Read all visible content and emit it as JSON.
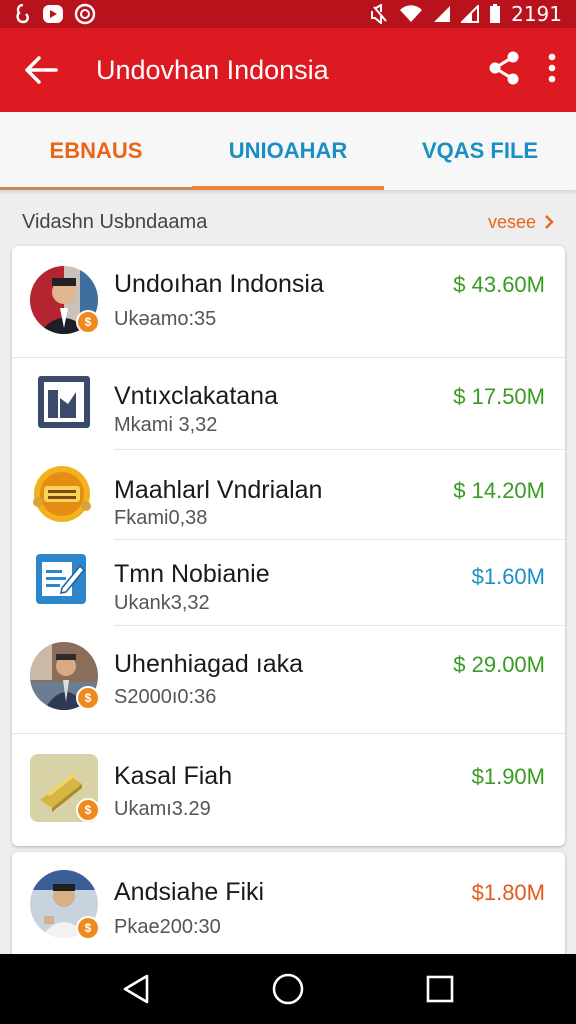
{
  "status_bar": {
    "time": "2191",
    "left_icons": [
      "notification-icon",
      "notification-icon",
      "notification-icon"
    ],
    "right_icons": [
      "mute-icon",
      "wifi-icon",
      "signal-icon",
      "signal-icon",
      "battery-icon"
    ]
  },
  "app_bar": {
    "title": "Undovhan Indonsia",
    "back_icon": "arrow-back-icon",
    "share_icon": "share-icon",
    "menu_icon": "more-vert-icon"
  },
  "tabs": [
    {
      "label": "EBNAUS",
      "color": "#e8661a"
    },
    {
      "label": "UNIOAHAR",
      "color": "#1b8fc4"
    },
    {
      "label": "VQAS FILE",
      "color": "#1b8fc4"
    }
  ],
  "section": {
    "title": "Vidashn Usbndaama",
    "link": "vesee"
  },
  "items": [
    {
      "name": "Undoıhan Indonsia",
      "sub": "Ukəamo:35",
      "amount": "$ 43.60M",
      "amount_color": "#3a9a24",
      "thumb": "person-avatar-icon",
      "badge": true
    },
    {
      "name": "Vntıxclakatana",
      "sub": "Mkami 3,32",
      "amount": "$ 17.50M",
      "amount_color": "#3a9a24",
      "thumb": "chart-app-icon",
      "badge": false
    },
    {
      "name": "Maahlarl Vndrialan",
      "sub": "Fkami0,38",
      "amount": "$ 14.20M",
      "amount_color": "#3a9a24",
      "thumb": "gold-badge-icon",
      "badge": false
    },
    {
      "name": "Tmn Nobianie",
      "sub": "Ukank3,32",
      "amount": "$1.60M",
      "amount_color": "#1b8fc4",
      "thumb": "edit-document-icon",
      "badge": false
    },
    {
      "name": "Uhenhiagad ıaka",
      "sub": "S2000ı0:36",
      "amount": "$ 29.00M",
      "amount_color": "#3a9a24",
      "thumb": "person-avatar-icon",
      "badge": true
    },
    {
      "name": "Kasal Fiah",
      "sub": "Ukamı3.29",
      "amount": "$1.90M",
      "amount_color": "#3a9a24",
      "thumb": "gold-bars-icon",
      "badge": true
    },
    {
      "name": "Andsiahe Fiki",
      "sub": "Pkae200:30",
      "amount": "$1.80M",
      "amount_color": "#e05a1c",
      "thumb": "person-avatar-icon",
      "badge": true
    }
  ],
  "nav_bar": {
    "back": "nav-back-icon",
    "home": "nav-home-icon",
    "recents": "nav-recents-icon"
  }
}
